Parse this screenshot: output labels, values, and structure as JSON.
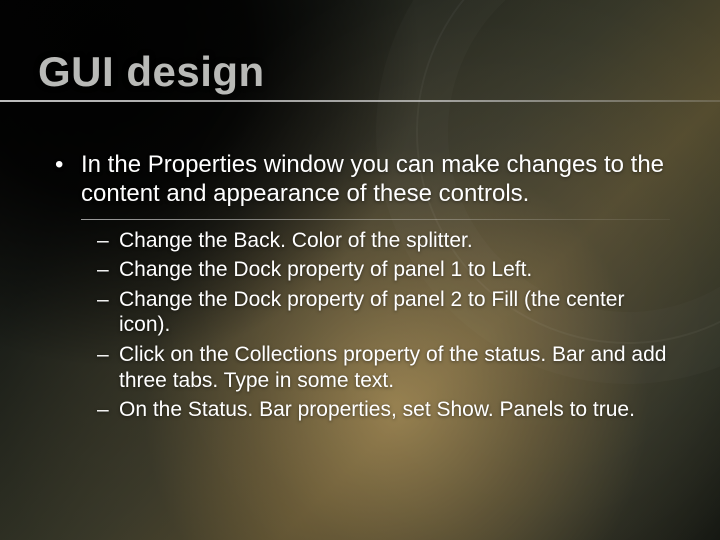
{
  "title": "GUI design",
  "main_bullet": "In the Properties window you can make changes to the content and appearance of these controls.",
  "sub_bullets": [
    "Change the Back. Color of the splitter.",
    "Change the Dock property of panel 1 to Left.",
    "Change the Dock property of panel 2 to Fill (the center icon).",
    "Click on the Collections property of the status. Bar and add three tabs. Type in some text.",
    "On the Status. Bar properties, set Show. Panels to true."
  ]
}
